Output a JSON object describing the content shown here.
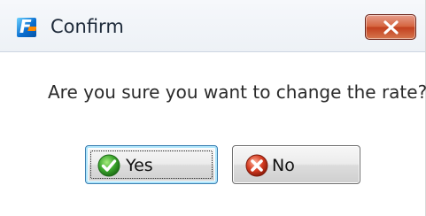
{
  "window": {
    "title": "Confirm",
    "icons": {
      "app": "app-logo-icon",
      "close": "close-icon"
    }
  },
  "message": "Are you sure you want to change the rate?",
  "buttons": {
    "yes": {
      "label": "Yes",
      "icon": "check-icon",
      "focused": true
    },
    "no": {
      "label": "No",
      "icon": "cancel-x-icon",
      "focused": false
    }
  },
  "colors": {
    "close_button": "#c94a28",
    "yes_icon": "#3aa52c",
    "no_icon": "#d43a20",
    "focus_border": "#3c7fb1"
  }
}
